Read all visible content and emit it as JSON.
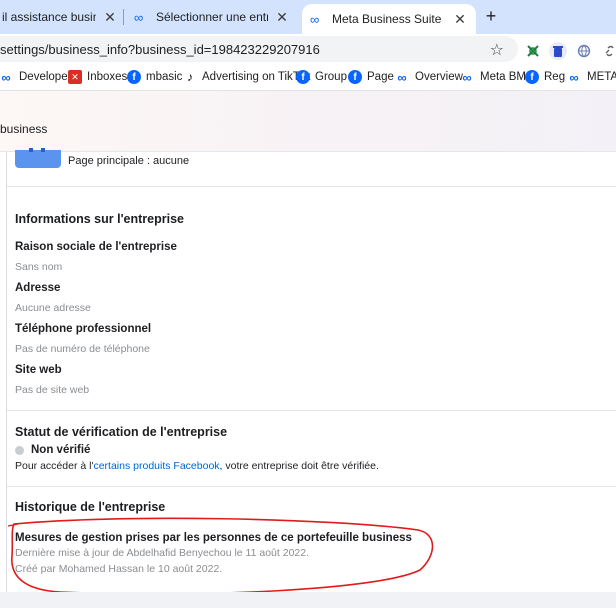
{
  "browser": {
    "tabs": [
      {
        "title": "il assistance business",
        "active": false
      },
      {
        "title": "Sélectionner une entreprise Fac",
        "active": false
      },
      {
        "title": "Meta Business Suite",
        "active": true
      }
    ],
    "new_tab_symbol": "+",
    "close_symbol": "✕",
    "address": "settings/business_info?business_id=198423229207916",
    "star_symbol": "☆",
    "bookmarks": [
      {
        "label": "Developers",
        "icon": "meta-icon"
      },
      {
        "label": "Inboxes",
        "icon": "x-icon"
      },
      {
        "label": "mbasic",
        "icon": "facebook-icon"
      },
      {
        "label": "Advertising on TikTok",
        "icon": "tiktok-icon"
      },
      {
        "label": "Group",
        "icon": "facebook-icon"
      },
      {
        "label": "Page",
        "icon": "facebook-icon"
      },
      {
        "label": "Overview",
        "icon": "meta-icon"
      },
      {
        "label": "Meta BM",
        "icon": "meta-icon"
      },
      {
        "label": "Reg",
        "icon": "facebook-icon"
      },
      {
        "label": "META",
        "icon": "meta-icon"
      }
    ]
  },
  "header": {
    "breadcrumb": "business"
  },
  "page_section": {
    "main_page": "Page principale : aucune"
  },
  "business_info": {
    "title": "Informations sur l'entreprise",
    "fields": [
      {
        "label": "Raison sociale de l'entreprise",
        "value": "Sans nom"
      },
      {
        "label": "Adresse",
        "value": "Aucune adresse"
      },
      {
        "label": "Téléphone professionnel",
        "value": "Pas de numéro de téléphone"
      },
      {
        "label": "Site web",
        "value": "Pas de site web"
      }
    ]
  },
  "verification": {
    "title": "Statut de vérification de l'entreprise",
    "status": "Non vérifié",
    "note_before": "Pour accéder à l'",
    "note_link": "certains produits Facebook",
    "note_after": ", votre entreprise doit être vérifiée."
  },
  "history": {
    "section_title": "Historique de l'entreprise",
    "title": "Mesures de gestion prises par les personnes de ce portefeuille business",
    "updated": "Dernière mise à jour de Abdelhafid Benyechou le 11 août 2022.",
    "created": "Créé par Mohamed Hassan le 10 août 2022."
  },
  "colors": {
    "accent": "#0866ff",
    "link": "#0064d1",
    "annotation": "#e01b1b"
  }
}
